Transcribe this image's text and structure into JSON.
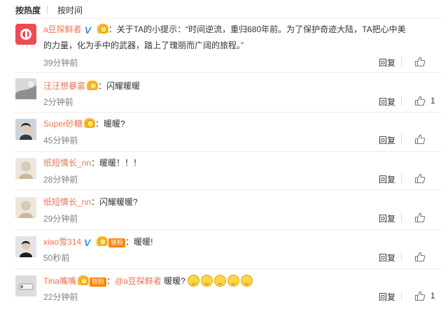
{
  "sort_tabs": [
    "按热度",
    "按时间"
  ],
  "sort_separator": "|",
  "reply_label": "回复",
  "colors": {
    "username": "#eb7350",
    "time": "#808080",
    "verified": "#3b8fe8"
  },
  "comments": [
    {
      "user": "a豆探鲜者",
      "verified": true,
      "badges": [
        "medal"
      ],
      "content_line1": "：关于TA的小提示：“时间逆流，重归680年前。为了保护奇迹大陆，TA把心中美",
      "content_line2": "的力量，化为手中的武器，踏上了瑰丽而广阔的旅程。”",
      "time": "39分钟前",
      "likes": "",
      "like_icon": "thumbs-up-icon",
      "avatar": "app-logo"
    },
    {
      "user": "汪汪想暴富",
      "badges": [
        "medal"
      ],
      "content": "：闪耀暖暖",
      "time": "2分钟前",
      "likes": "1",
      "like_icon": "thumbs-up-icon"
    },
    {
      "user": "Super砂糖",
      "badges": [
        "medal"
      ],
      "content": "：暖暖?",
      "time": "45分钟前",
      "likes": "",
      "like_icon": "thumbs-up-icon"
    },
    {
      "user": "纸短情长_nn",
      "content": "：暖暖！！！",
      "time": "28分钟前",
      "likes": "",
      "like_icon": "thumbs-up-icon"
    },
    {
      "user": "纸短情长_nn",
      "content": "：闪耀暖暖?",
      "time": "29分钟前",
      "likes": "",
      "like_icon": "thumbs-up-icon"
    },
    {
      "user": "xiao雪314",
      "verified": true,
      "badges": [
        "medal",
        "fan"
      ],
      "fan_label": "铁粉",
      "content": "：暖暖!",
      "time": "50秒前",
      "likes": "",
      "like_icon": "thumbs-up-icon"
    },
    {
      "user": "Tina嘴嘴",
      "badges": [
        "medal",
        "fan"
      ],
      "fan_label": "铁粉",
      "content_prefix": "：",
      "mention": "@a豆探鲜者",
      "content": " 暖暖?",
      "emoji_count": 5,
      "time": "22分钟前",
      "likes": "1",
      "like_icon": "thumbs-up-icon"
    }
  ]
}
